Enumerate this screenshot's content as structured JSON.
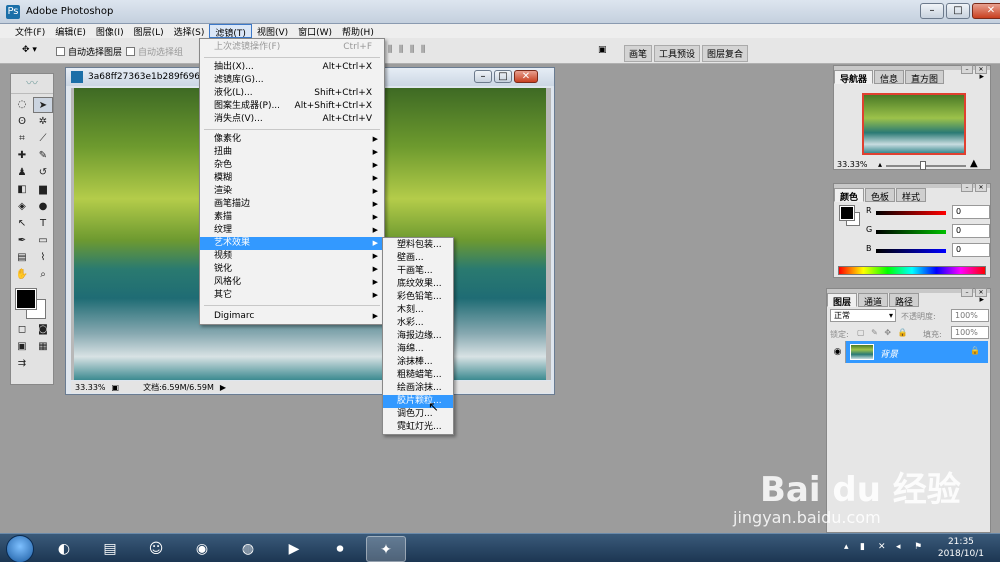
{
  "window": {
    "title": "Adobe Photoshop"
  },
  "menubar": {
    "items": [
      "文件(F)",
      "编辑(E)",
      "图像(I)",
      "图层(L)",
      "选择(S)",
      "滤镜(T)",
      "视图(V)",
      "窗口(W)",
      "帮助(H)"
    ],
    "active": "滤镜(T)"
  },
  "options": {
    "auto_select_layer": "自动选择图层",
    "auto_select_group": "自动选择组"
  },
  "dock_tabs": [
    "画笔",
    "工具预设",
    "图层复合"
  ],
  "document": {
    "title": "3a68ff27363e1b289f69628",
    "zoom": "33.33%",
    "doc_info": "文档:6.59M/6.59M"
  },
  "filter_menu": {
    "last_filter": {
      "label": "上次滤镜操作(F)",
      "shortcut": "Ctrl+F"
    },
    "group1": [
      {
        "label": "抽出(X)...",
        "shortcut": "Alt+Ctrl+X"
      },
      {
        "label": "滤镜库(G)...",
        "shortcut": ""
      },
      {
        "label": "液化(L)...",
        "shortcut": "Shift+Ctrl+X"
      },
      {
        "label": "图案生成器(P)...",
        "shortcut": "Alt+Shift+Ctrl+X"
      },
      {
        "label": "消失点(V)...",
        "shortcut": "Alt+Ctrl+V"
      }
    ],
    "submenus": [
      "像素化",
      "扭曲",
      "杂色",
      "模糊",
      "渲染",
      "画笔描边",
      "素描",
      "纹理",
      "艺术效果",
      "视频",
      "锐化",
      "风格化",
      "其它"
    ],
    "highlighted": "艺术效果",
    "plugin": "Digimarc"
  },
  "artistic_submenu": {
    "items": [
      "塑料包装...",
      "壁画...",
      "干画笔...",
      "底纹效果...",
      "彩色铅笔...",
      "木刻...",
      "水彩...",
      "海报边缘...",
      "海绵...",
      "涂抹棒...",
      "粗糙蜡笔...",
      "绘画涂抹...",
      "胶片颗粒...",
      "调色刀...",
      "霓虹灯光..."
    ],
    "highlighted": "胶片颗粒..."
  },
  "navigator_panel": {
    "tabs": [
      "导航器",
      "信息",
      "直方图"
    ],
    "zoom": "33.33%"
  },
  "color_panel": {
    "tabs": [
      "颜色",
      "色板",
      "样式"
    ],
    "channels": [
      {
        "name": "R",
        "value": "0",
        "color": "#ff0000"
      },
      {
        "name": "G",
        "value": "0",
        "color": "#00c000"
      },
      {
        "name": "B",
        "value": "0",
        "color": "#0000ff"
      }
    ]
  },
  "layers_panel": {
    "tabs": [
      "图层",
      "通道",
      "路径"
    ],
    "blend_mode": "正常",
    "opacity_label": "不透明度:",
    "opacity_value": "100%",
    "lock_label": "锁定:",
    "fill_label": "填充:",
    "fill_value": "100%",
    "layer_name": "背景"
  },
  "watermark": {
    "brand": "Bai du 经验",
    "url": "jingyan.baidu.com"
  },
  "taskbar": {
    "clock_time": "21:35",
    "clock_date": "2018/10/1"
  }
}
